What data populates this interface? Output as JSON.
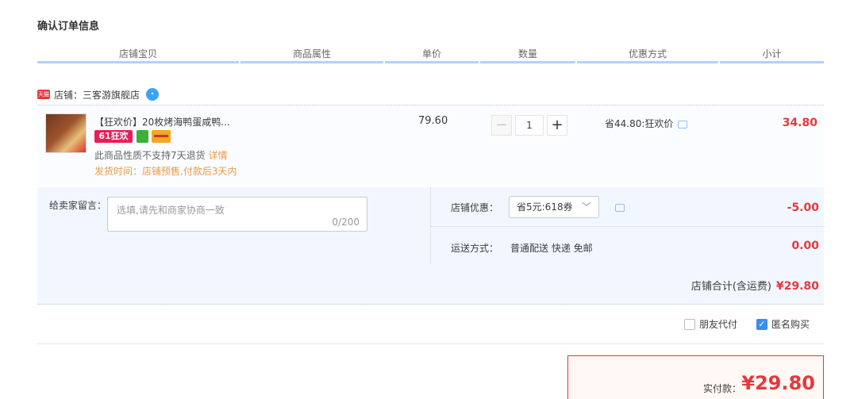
{
  "page_title": "确认订单信息",
  "columns": [
    "店铺宝贝",
    "商品属性",
    "单价",
    "数量",
    "优惠方式",
    "小计"
  ],
  "shop": {
    "badge": "天猫",
    "label": "店铺：三客游旗舰店"
  },
  "item": {
    "title": "【狂欢价】20枚烤海鸭蛋咸鸭...",
    "tag_61": "61狂欢",
    "no_return": "此商品性质不支持7天退货",
    "detail_link": "详情",
    "ship_time": "发货时间：店铺预售,付款后3天内",
    "unit_price": "79.60",
    "qty_minus": "−",
    "qty_value": "1",
    "qty_plus": "+",
    "promo": "省44.80:狂欢价",
    "subtotal": "34.80"
  },
  "message": {
    "label": "给卖家留言：",
    "placeholder": "选填,请先和商家协商一致",
    "count": "0/200"
  },
  "discount": {
    "label": "店铺优惠：",
    "selected": "省5元:618券",
    "amount": "-5.00"
  },
  "shipping": {
    "label": "运送方式：",
    "value": "普通配送 快递 免邮",
    "amount": "0.00"
  },
  "shop_total": {
    "label": "店铺合计(含运费)",
    "value": "¥29.80"
  },
  "options": {
    "friend_pay": "朋友代付",
    "anonymous": "匿名购买"
  },
  "payment": {
    "label": "实付款：",
    "value": "¥29.80"
  }
}
